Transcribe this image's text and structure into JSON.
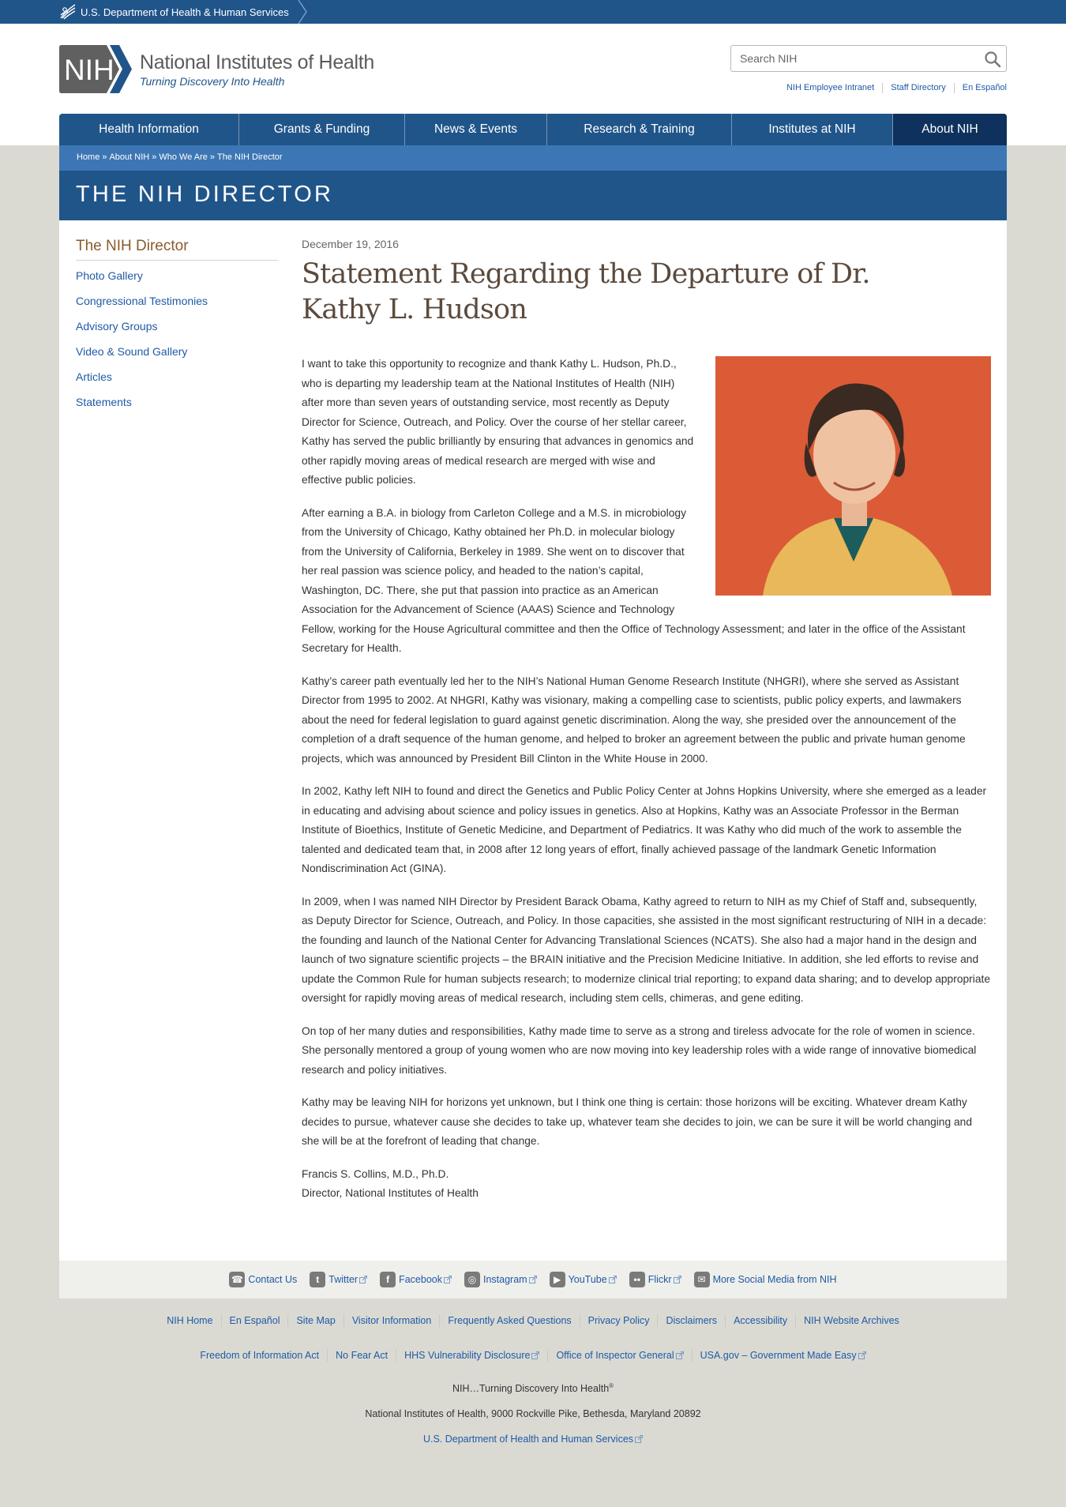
{
  "hhs": {
    "label": "U.S. Department of Health & Human Services"
  },
  "logo": {
    "mark": "NIH",
    "title": "National Institutes of Health",
    "tagline": "Turning Discovery Into Health"
  },
  "search": {
    "placeholder": "Search NIH"
  },
  "utility_links": [
    "NIH Employee Intranet",
    "Staff Directory",
    "En Español"
  ],
  "nav": [
    "Health Information",
    "Grants & Funding",
    "News & Events",
    "Research & Training",
    "Institutes at NIH",
    "About NIH"
  ],
  "breadcrumb": [
    "Home",
    "About NIH",
    "Who We Are",
    "The NIH Director"
  ],
  "page_title": "THE NIH DIRECTOR",
  "sidebar": {
    "title": "The NIH Director",
    "items": [
      "Photo Gallery",
      "Congressional Testimonies",
      "Advisory Groups",
      "Video & Sound Gallery",
      "Articles",
      "Statements"
    ]
  },
  "article": {
    "date": "December 19, 2016",
    "headline": "Statement Regarding the Departure of Dr. Kathy L. Hudson",
    "paragraphs": [
      "I want to take this opportunity to recognize and thank Kathy L. Hudson, Ph.D., who is departing my leadership team at the National Institutes of Health (NIH) after more than seven years of outstanding service, most recently as Deputy Director for Science, Outreach, and Policy. Over the course of her stellar career, Kathy has served the public brilliantly by ensuring that advances in genomics and other rapidly moving areas of medical research are merged with wise and effective public policies.",
      "After earning a B.A. in biology from Carleton College and a M.S. in microbiology from the University of Chicago, Kathy obtained her Ph.D. in molecular biology from the University of California, Berkeley in 1989. She went on to discover that her real passion was science policy, and headed to the nation’s capital, Washington, DC. There, she put that passion into practice as an American Association for the Advancement of Science (AAAS) Science and Technology Fellow, working for the House Agricultural committee and then the Office of Technology Assessment; and later in the office of the Assistant Secretary for Health.",
      "Kathy’s career path eventually led her to the NIH’s National Human Genome Research Institute (NHGRI), where she served as Assistant Director from 1995 to 2002. At NHGRI, Kathy was visionary, making a compelling case to scientists, public policy experts, and lawmakers about the need for federal legislation to guard against genetic discrimination. Along the way, she presided over the announcement of the completion of a draft sequence of the human genome, and helped to broker an agreement between the public and private human genome projects, which was announced by President Bill Clinton in the White House in 2000.",
      "In 2002, Kathy left NIH to found and direct the Genetics and Public Policy Center at Johns Hopkins University, where she emerged as a leader in educating and advising about science and policy issues in genetics. Also at Hopkins, Kathy was an Associate Professor in the Berman Institute of Bioethics, Institute of Genetic Medicine, and Department of Pediatrics. It was Kathy who did much of the work to assemble the talented and dedicated team that, in 2008 after 12 long years of effort, finally achieved passage of the landmark Genetic Information Nondiscrimination Act (GINA).",
      "In 2009, when I was named NIH Director by President Barack Obama, Kathy agreed to return to NIH as my Chief of Staff and, subsequently, as Deputy Director for Science, Outreach, and Policy. In those capacities, she assisted in the most significant restructuring of NIH in a decade: the founding and launch of the National Center for Advancing Translational Sciences (NCATS). She also had a major hand in the design and launch of two signature scientific projects – the BRAIN initiative and the Precision Medicine Initiative. In addition, she led efforts to revise and update the Common Rule for human subjects research; to modernize clinical trial reporting; to expand data sharing; and to develop appropriate oversight for rapidly moving areas of medical research, including stem cells, chimeras, and gene editing.",
      "On top of her many duties and responsibilities, Kathy made time to serve as a strong and tireless advocate for the role of women in science. She personally mentored a group of young women who are now moving into key leadership roles with a wide range of innovative biomedical research and policy initiatives.",
      "Kathy may be leaving NIH for horizons yet unknown, but I think one thing is certain: those horizons will be exciting. Whatever dream Kathy decides to pursue, whatever cause she decides to take up, whatever team she decides to join, we can be sure it will be world changing and she will be at the forefront of leading that change."
    ],
    "signature_name": "Francis S. Collins, M.D., Ph.D.",
    "signature_title": "Director, National Institutes of Health"
  },
  "social": [
    {
      "label": "Contact Us",
      "icon": "phone-icon"
    },
    {
      "label": "Twitter",
      "icon": "twitter-icon"
    },
    {
      "label": "Facebook",
      "icon": "facebook-icon"
    },
    {
      "label": "Instagram",
      "icon": "instagram-icon"
    },
    {
      "label": "YouTube",
      "icon": "youtube-icon"
    },
    {
      "label": "Flickr",
      "icon": "flickr-icon"
    },
    {
      "label": "More Social Media from NIH",
      "icon": "chat-icon"
    }
  ],
  "footer": {
    "row1": [
      "NIH Home",
      "En Español",
      "Site Map",
      "Visitor Information",
      "Frequently Asked Questions",
      "Privacy Policy",
      "Disclaimers",
      "Accessibility",
      "NIH Website Archives"
    ],
    "row2": [
      "Freedom of Information Act",
      "No Fear Act",
      "HHS Vulnerability Disclosure",
      "Office of Inspector General",
      "USA.gov – Government Made Easy"
    ],
    "tagline": "NIH…Turning Discovery Into Health",
    "tagline_mark": "®",
    "address": "National Institutes of Health, 9000 Rockville Pike, Bethesda, Maryland 20892",
    "hhs_link": "U.S. Department of Health and Human Services"
  },
  "colors": {
    "hhs_bar": "#20558a",
    "nav": "#20558a",
    "nav_active": "#0e325d",
    "breadcrumb_band": "#3d76b4",
    "sidebar_title": "#8b5a2b",
    "link": "#1f5aa6",
    "page_bg": "#dadad3"
  }
}
